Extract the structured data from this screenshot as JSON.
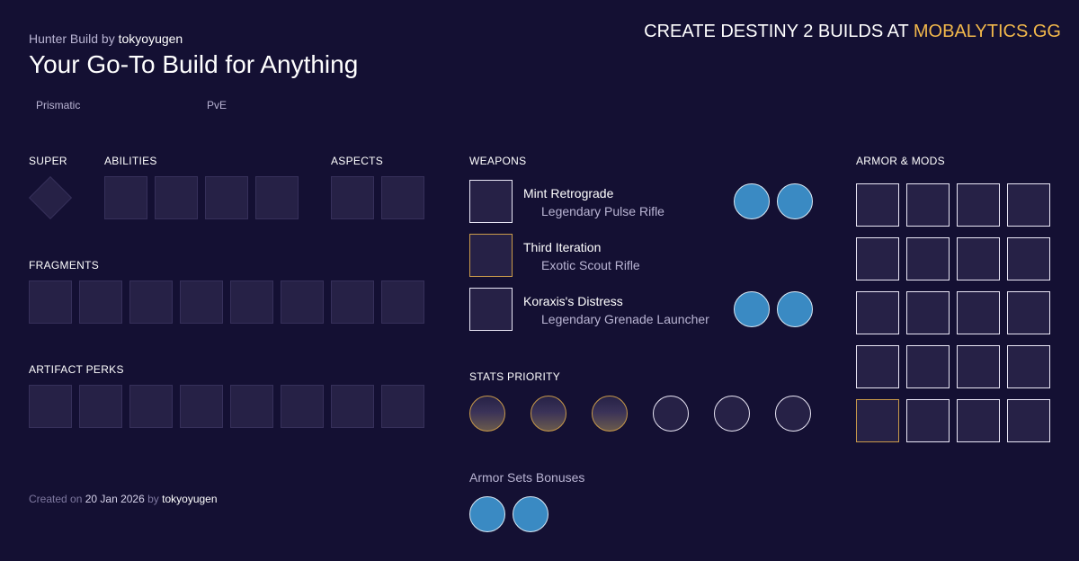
{
  "header": {
    "class_label": "Hunter Build by",
    "author": "tokyoyugen",
    "title": "Your Go-To Build for Anything",
    "promo_text": "CREATE DESTINY 2 BUILDS AT",
    "promo_site": "MOBALYTICS.GG"
  },
  "tags": {
    "subclass": "Prismatic",
    "mode": "PvE"
  },
  "sections": {
    "super": "SUPER",
    "abilities": "ABILITIES",
    "aspects": "ASPECTS",
    "fragments": "FRAGMENTS",
    "artifact_perks": "ARTIFACT PERKS",
    "weapons": "WEAPONS",
    "armor_mods": "ARMOR & MODS",
    "stats_priority": "STATS PRIORITY",
    "armor_sets": "Armor Sets Bonuses"
  },
  "weapons": [
    {
      "name": "Mint Retrograde",
      "type": "Legendary Pulse Rifle",
      "frame": "white",
      "mods": 2
    },
    {
      "name": "Third Iteration",
      "type": "Exotic Scout Rifle",
      "frame": "gold",
      "mods": 0
    },
    {
      "name": "Koraxis's Distress",
      "type": "Legendary Grenade Launcher",
      "frame": "white",
      "mods": 2
    }
  ],
  "footer": {
    "created_on": "Created on",
    "date": "20 Jan 2026",
    "by": "by",
    "author": "tokyoyugen"
  },
  "colors": {
    "background": "#141033",
    "accent_gold": "#f2b84b",
    "mod_blue": "#3a8ac3"
  }
}
